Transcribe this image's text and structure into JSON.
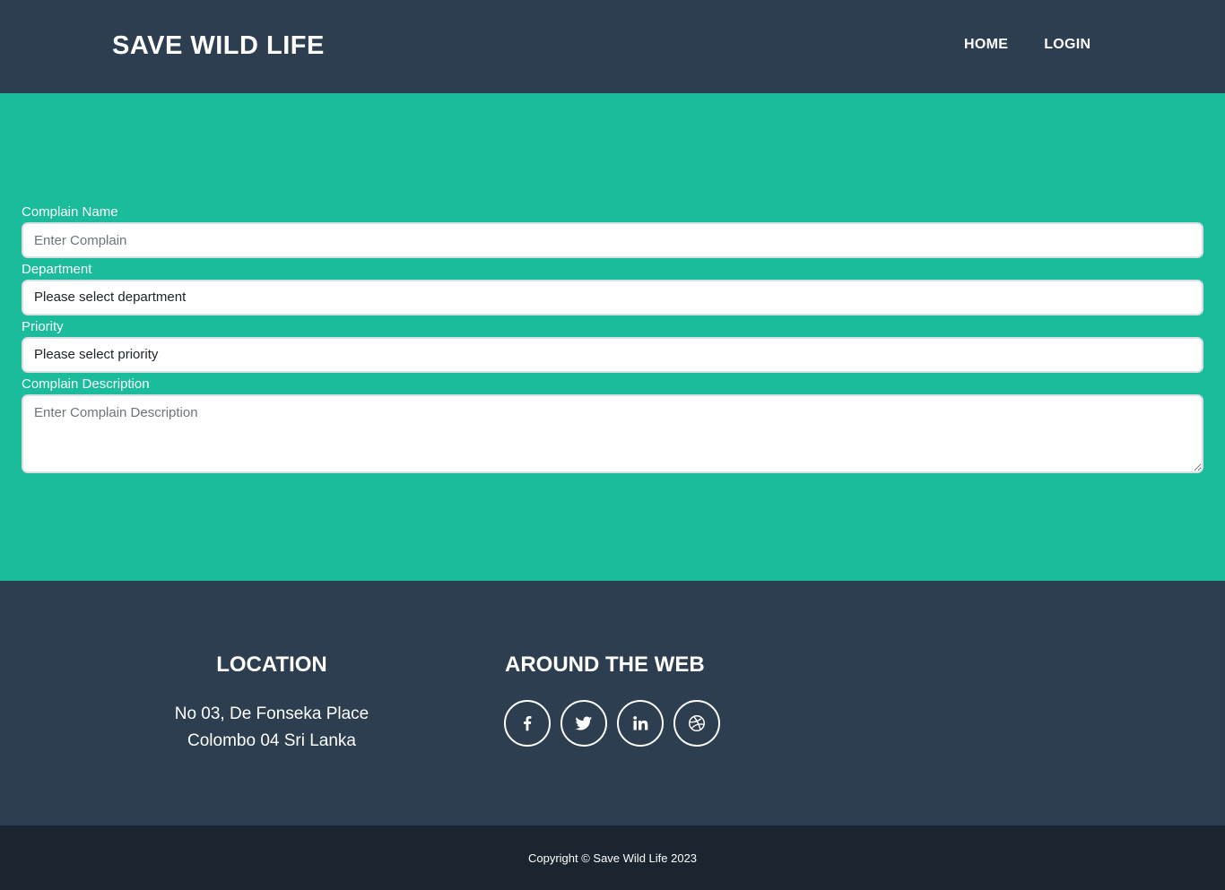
{
  "navbar": {
    "brand": "SAVE WILD LIFE",
    "links": [
      {
        "label": "HOME"
      },
      {
        "label": "LOGIN"
      }
    ]
  },
  "form": {
    "complain_name": {
      "label": "Complain Name",
      "placeholder": "Enter Complain",
      "value": ""
    },
    "department": {
      "label": "Department",
      "selected": "Please select department"
    },
    "priority": {
      "label": "Priority",
      "selected": "Please select priority"
    },
    "description": {
      "label": "Complain Description",
      "placeholder": "Enter Complain Description",
      "value": ""
    }
  },
  "footer": {
    "location": {
      "title": "LOCATION",
      "line1": "No 03, De Fonseka Place",
      "line2": "Colombo 04 Sri Lanka"
    },
    "web": {
      "title": "AROUND THE WEB",
      "icons": [
        "facebook-icon",
        "twitter-icon",
        "linkedin-icon",
        "dribbble-icon"
      ]
    },
    "copyright": "Copyright © Save Wild Life 2023"
  },
  "colors": {
    "navbar_bg": "#2c3e50",
    "main_bg": "#1abc9c",
    "footer_bg": "#2c3e50",
    "copyright_bg": "#1a252f",
    "text_light": "#ffffff"
  }
}
